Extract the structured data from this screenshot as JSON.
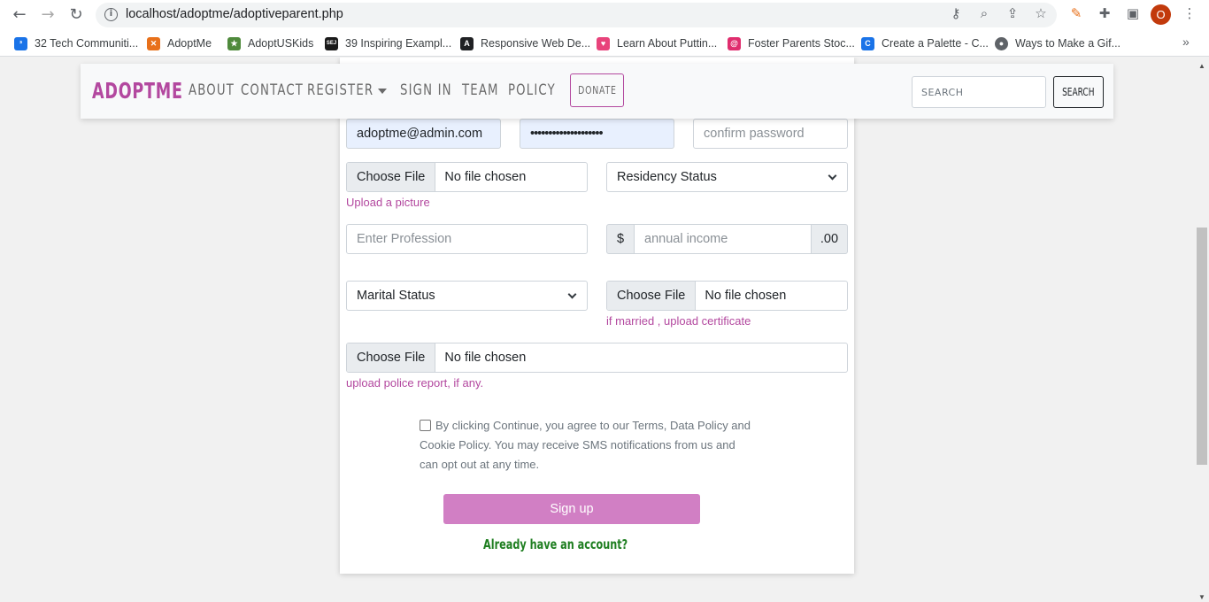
{
  "browser": {
    "url": "localhost/adoptme/adoptiveparent.php",
    "profile_initial": "O",
    "bookmarks": [
      {
        "label": "32 Tech Communiti...",
        "color": "#1a73e8",
        "glyph": "³"
      },
      {
        "label": "AdoptMe",
        "color": "#e8701a",
        "glyph": "✕"
      },
      {
        "label": "AdoptUSKids",
        "color": "#4f8a3c",
        "glyph": "★"
      },
      {
        "label": "39 Inspiring Exampl...",
        "color": "#1a1a1a",
        "glyph": "SEJ"
      },
      {
        "label": "Responsive Web De...",
        "color": "#202124",
        "glyph": "A"
      },
      {
        "label": "Learn About Puttin...",
        "color": "#e8437b",
        "glyph": "♥"
      },
      {
        "label": "Foster Parents Stoc...",
        "color": "#e02d6e",
        "glyph": "@"
      },
      {
        "label": "Create a Palette - C...",
        "color": "#1a73e8",
        "glyph": "C"
      },
      {
        "label": "Ways to Make a Gif...",
        "color": "#5f6368",
        "glyph": "●"
      }
    ]
  },
  "navbar": {
    "brand": "ADOPTME",
    "links": [
      "ABOUT",
      "CONTACT",
      "REGISTER",
      "SIGN IN",
      "TEAM",
      "POLICY"
    ],
    "donate": "DONATE",
    "search_placeholder": "SEARCH",
    "search_button": "SEARCH"
  },
  "form": {
    "email_value": "adoptme@admin.com",
    "password_value": "••••••••••••••••••••",
    "confirm_placeholder": "confirm password",
    "choose_file": "Choose File",
    "no_file": "No file chosen",
    "picture_hint": "Upload a picture",
    "residency_select": "Residency Status",
    "profession_placeholder": "Enter Profession",
    "currency_symbol": "$",
    "income_placeholder": "annual income",
    "income_suffix": ".00",
    "marital_select": "Marital Status",
    "certificate_hint": "if married , upload certificate",
    "police_hint": "upload police report, if any.",
    "terms_text": "By clicking Continue, you agree to our Terms, Data Policy and Cookie Policy. You may receive SMS notifications from us and can opt out at any time.",
    "signup_button": "Sign up",
    "login_link": "Already have an account?"
  },
  "colors": {
    "brand": "#b3489f",
    "signup": "#d17fc4",
    "login_link": "#1e7e20"
  }
}
